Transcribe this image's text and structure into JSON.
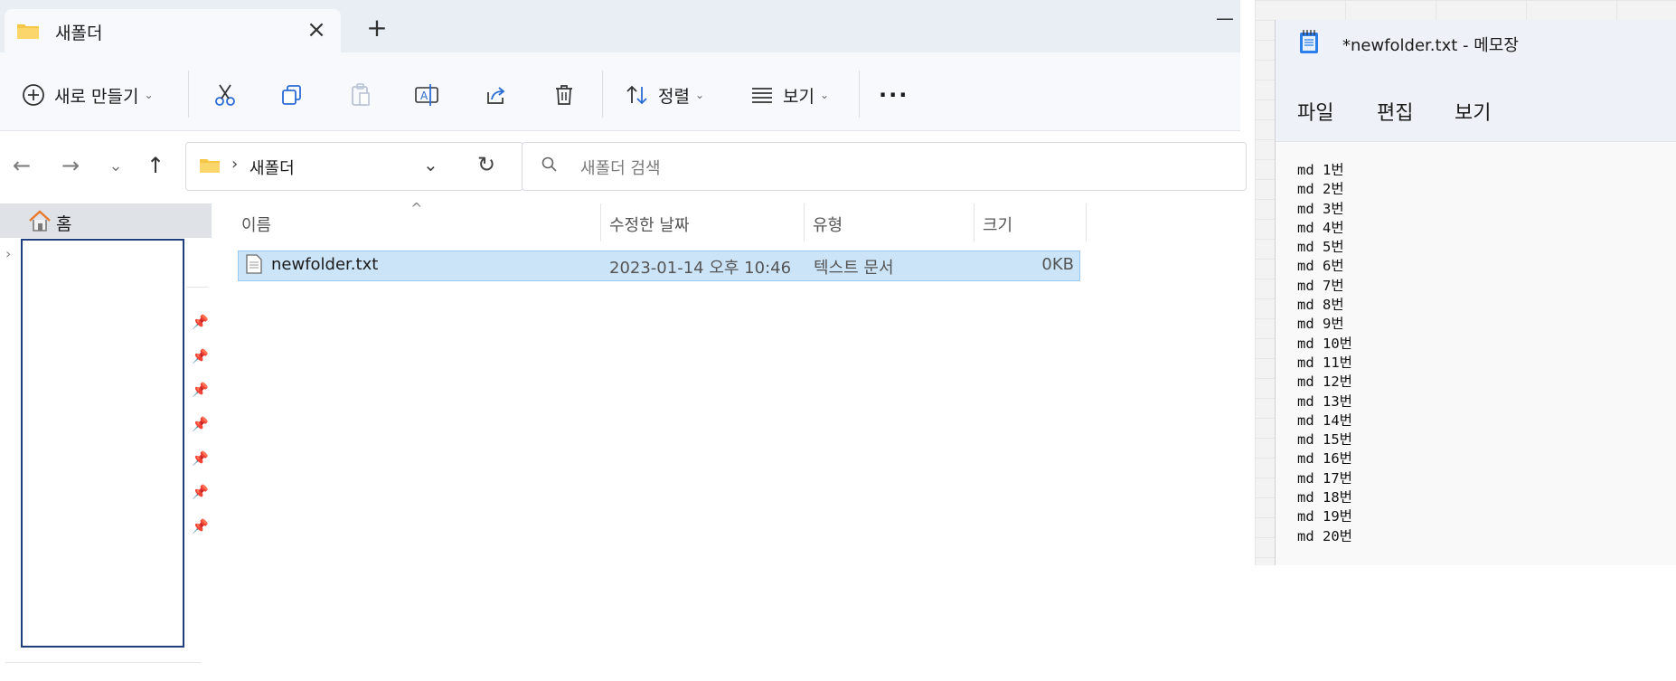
{
  "explorer": {
    "tab_title": "새폴더",
    "new_tab_label": "+",
    "toolbar": {
      "new_label": "새로 만들기",
      "sort_label": "정렬",
      "view_label": "보기",
      "more_label": "···"
    },
    "address": {
      "separator": "›",
      "folder": "새폴더"
    },
    "search": {
      "placeholder": "새폴더 검색"
    },
    "nav": {
      "home_label": "홈"
    },
    "columns": {
      "name": "이름",
      "modified": "수정한 날짜",
      "type": "유형",
      "size": "크기"
    },
    "files": [
      {
        "name": "newfolder.txt",
        "modified": "2023-01-14 오후 10:46",
        "type": "텍스트 문서",
        "size": "0KB",
        "selected": true
      }
    ]
  },
  "notepad": {
    "title": "*newfolder.txt - 메모장",
    "menu": {
      "file": "파일",
      "edit": "편집",
      "view": "보기"
    },
    "lines": [
      "md 1번",
      "md 2번",
      "md 3번",
      "md 4번",
      "md 5번",
      "md 6번",
      "md 7번",
      "md 8번",
      "md 9번",
      "md 10번",
      "md 11번",
      "md 12번",
      "md 13번",
      "md 14번",
      "md 15번",
      "md 16번",
      "md 17번",
      "md 18번",
      "md 19번",
      "md 20번"
    ]
  },
  "colors": {
    "selection": "#cce4f7",
    "selection_border": "#98c8ef",
    "folder_yellow": "#f6c744",
    "home_orange": "#e87a2e",
    "nav_box_border": "#1f3e7d",
    "notepad_icon": "#2b7de9"
  }
}
